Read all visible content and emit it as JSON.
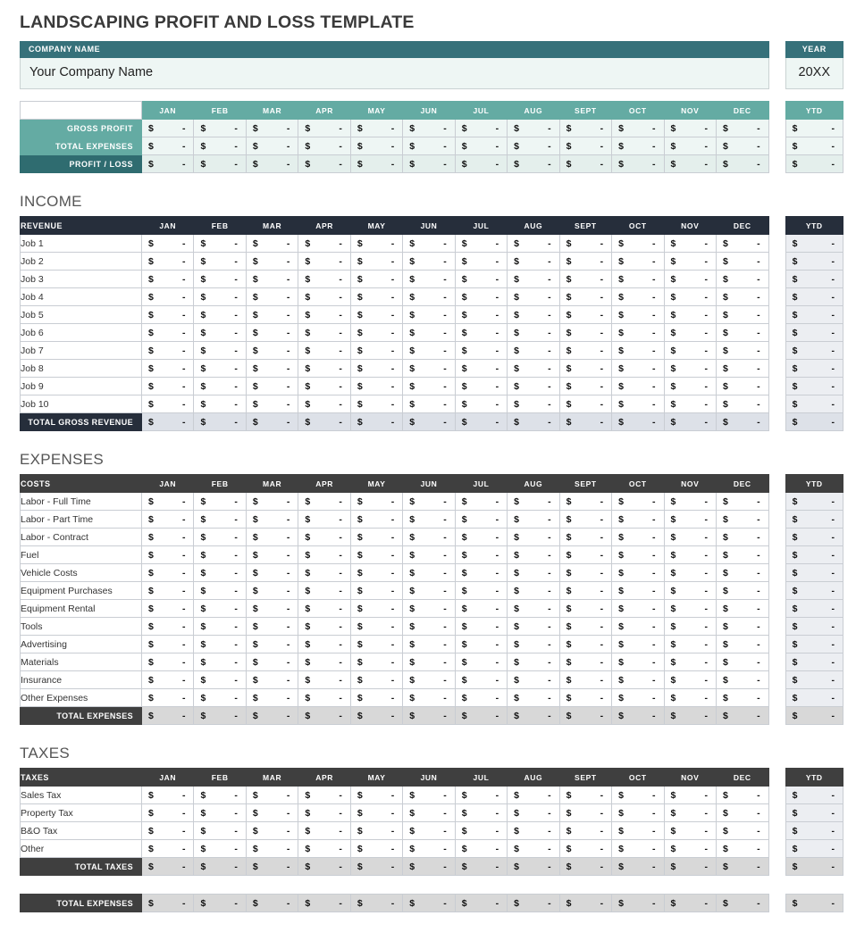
{
  "document": {
    "title": "LANDSCAPING PROFIT AND LOSS TEMPLATE"
  },
  "colors": {
    "teal_dark": "#36717a",
    "teal_light": "#64aba3",
    "navy": "#262e3b",
    "gray": "#3f3f3f",
    "mint": "#eef6f4"
  },
  "company": {
    "header_label": "COMPANY NAME",
    "value": "Your Company Name",
    "placeholder": "Your Company Name"
  },
  "year": {
    "header_label": "YEAR",
    "value": "20XX",
    "placeholder": "20XX"
  },
  "months": [
    "JAN",
    "FEB",
    "MAR",
    "APR",
    "MAY",
    "JUN",
    "JUL",
    "AUG",
    "SEPT",
    "OCT",
    "NOV",
    "DEC"
  ],
  "ytd_label": "YTD",
  "currency_symbol": "$",
  "empty_value": "-",
  "summary": {
    "rows": [
      {
        "label": "GROSS PROFIT",
        "style": "teal-light"
      },
      {
        "label": "TOTAL EXPENSES",
        "style": "teal-light"
      },
      {
        "label": "PROFIT / LOSS",
        "style": "teal-dark"
      }
    ]
  },
  "income": {
    "section_title": "INCOME",
    "header_label": "REVENUE",
    "rows": [
      "Job 1",
      "Job 2",
      "Job 3",
      "Job 4",
      "Job 5",
      "Job 6",
      "Job 7",
      "Job 8",
      "Job 9",
      "Job 10"
    ],
    "total_label": "TOTAL GROSS REVENUE"
  },
  "expenses": {
    "section_title": "EXPENSES",
    "header_label": "COSTS",
    "rows": [
      "Labor - Full Time",
      "Labor - Part Time",
      "Labor - Contract",
      "Fuel",
      "Vehicle Costs",
      "Equipment Purchases",
      "Equipment Rental",
      "Tools",
      "Advertising",
      "Materials",
      "Insurance",
      "Other Expenses"
    ],
    "total_label": "TOTAL EXPENSES"
  },
  "taxes": {
    "section_title": "TAXES",
    "header_label": "TAXES",
    "rows": [
      "Sales Tax",
      "Property Tax",
      "B&O Tax",
      "Other"
    ],
    "total_label": "TOTAL TAXES"
  },
  "grand_total": {
    "label": "TOTAL EXPENSES"
  }
}
